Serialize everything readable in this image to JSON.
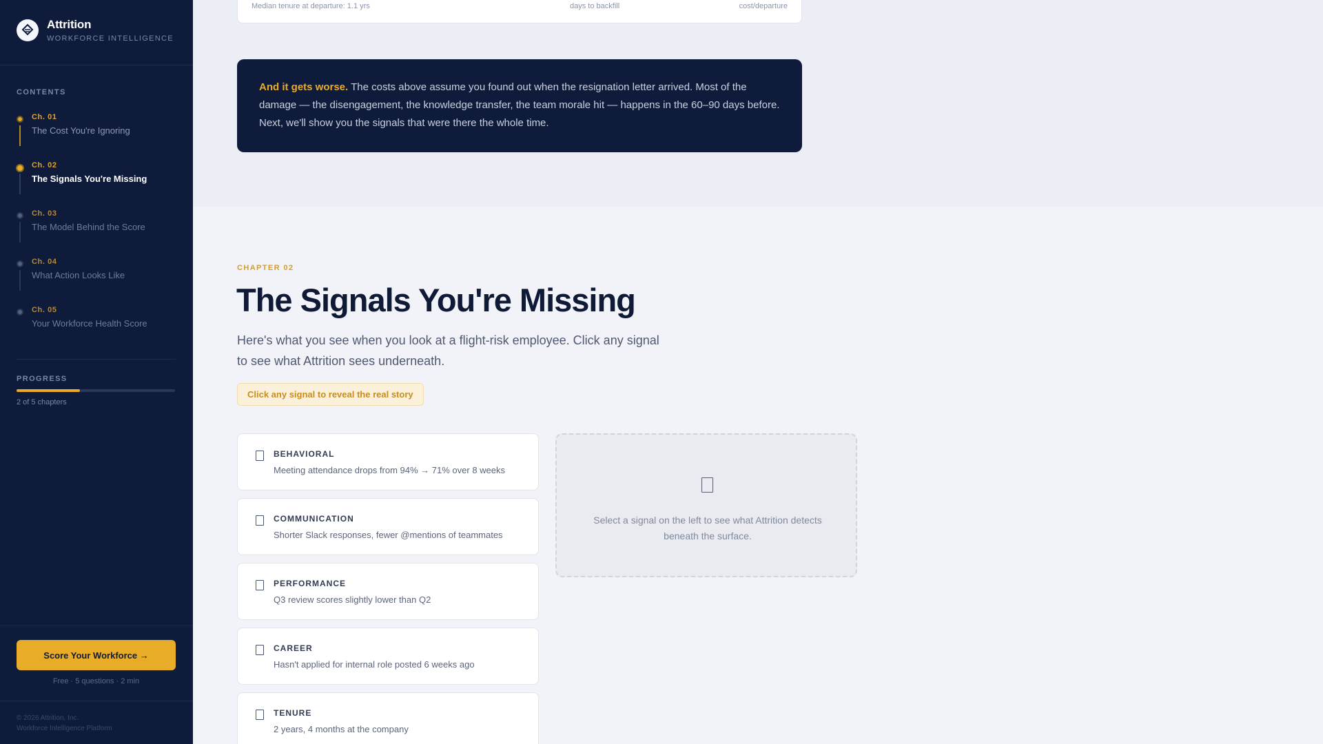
{
  "brand": {
    "name": "Attrition",
    "subtitle": "WORKFORCE INTELLIGENCE"
  },
  "sidebar": {
    "contents_label": "CONTENTS",
    "chapters": [
      {
        "num": "Ch. 01",
        "title": "The Cost You're Ignoring",
        "state": "done"
      },
      {
        "num": "Ch. 02",
        "title": "The Signals You're Missing",
        "state": "active"
      },
      {
        "num": "Ch. 03",
        "title": "The Model Behind the Score",
        "state": "future"
      },
      {
        "num": "Ch. 04",
        "title": "What Action Looks Like",
        "state": "future"
      },
      {
        "num": "Ch. 05",
        "title": "Your Workforce Health Score",
        "state": "future"
      }
    ],
    "progress_label": "PROGRESS",
    "progress_value": 0.4,
    "progress_text": "2 of 5 chapters",
    "cta_label": "Score Your Workforce →",
    "cta_note": "Free · 5 questions · 2 min",
    "footer_line1": "© 2026 Attrition, Inc.",
    "footer_line2": "Workforce Intelligence Platform"
  },
  "stats": {
    "left": "Median tenure at departure: 1.1 yrs",
    "middle": "days to backfill",
    "right": "cost/departure"
  },
  "callout": {
    "strong": "And it gets worse.",
    "text": " The costs above assume you found out when the resignation letter arrived. Most of the damage — the disengagement, the knowledge transfer, the team morale hit — happens in the 60–90 days before. Next, we'll show you the signals that were there the whole time."
  },
  "main": {
    "chapter_tag": "CHAPTER 02",
    "title": "The Signals You're Missing",
    "lead": "Here's what you see when you look at a flight-risk employee. Click any signal to see what Attrition sees underneath.",
    "hint": "Click any signal to reveal the real story"
  },
  "signals": [
    {
      "category": "BEHAVIORAL",
      "description": "Meeting attendance drops from 94% → 71% over 8 weeks"
    },
    {
      "category": "COMMUNICATION",
      "description": "Shorter Slack responses, fewer @mentions of teammates"
    },
    {
      "category": "PERFORMANCE",
      "description": "Q3 review scores slightly lower than Q2"
    },
    {
      "category": "CAREER",
      "description": "Hasn't applied for internal role posted 6 weeks ago"
    },
    {
      "category": "TENURE",
      "description": "2 years, 4 months at the company"
    }
  ],
  "detail": {
    "placeholder": "Select a signal on the left to see what Attrition detects beneath the surface."
  },
  "colors": {
    "accent": "#e8ac29",
    "navy": "#0f1b3a",
    "background": "#f2f3f8"
  }
}
